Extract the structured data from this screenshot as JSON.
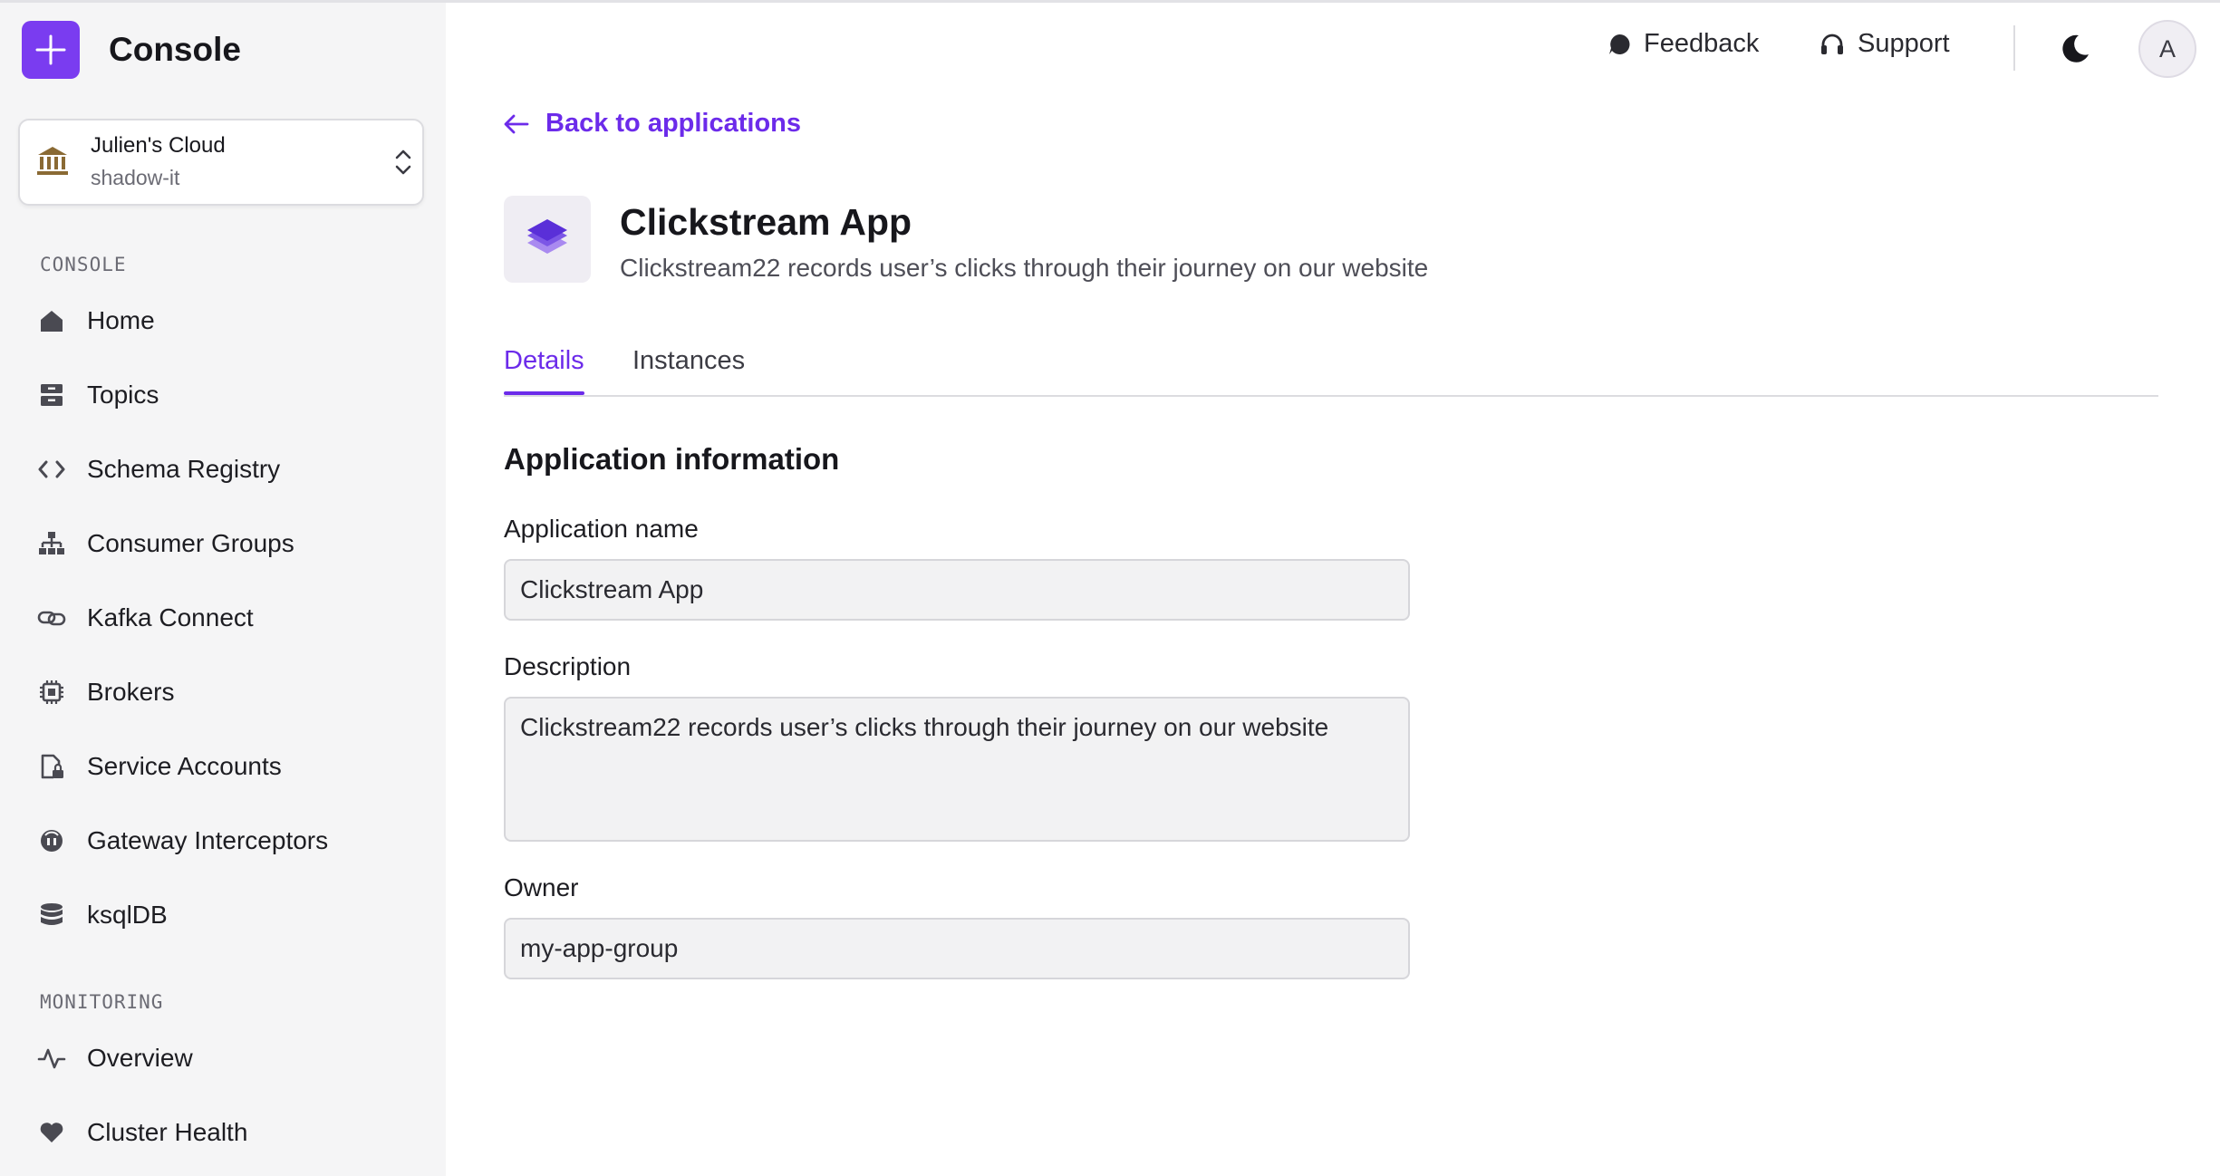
{
  "app": {
    "name": "Console",
    "accent": "#7a3cf0",
    "link_color": "#6c2bea"
  },
  "org": {
    "name": "Julien's Cloud",
    "sub": "shadow-it"
  },
  "sidebar": {
    "sections": [
      {
        "label": "CONSOLE",
        "items": [
          {
            "label": "Home",
            "icon": "home-icon"
          },
          {
            "label": "Topics",
            "icon": "topics-icon"
          },
          {
            "label": "Schema Registry",
            "icon": "code-icon"
          },
          {
            "label": "Consumer Groups",
            "icon": "hierarchy-icon"
          },
          {
            "label": "Kafka Connect",
            "icon": "link-icon"
          },
          {
            "label": "Brokers",
            "icon": "chip-icon"
          },
          {
            "label": "Service Accounts",
            "icon": "file-lock-icon"
          },
          {
            "label": "Gateway Interceptors",
            "icon": "gateway-icon"
          },
          {
            "label": "ksqlDB",
            "icon": "database-icon"
          }
        ]
      },
      {
        "label": "MONITORING",
        "items": [
          {
            "label": "Overview",
            "icon": "activity-icon"
          },
          {
            "label": "Cluster Health",
            "icon": "heart-icon"
          }
        ]
      }
    ]
  },
  "topbar": {
    "feedback": "Feedback",
    "support": "Support",
    "avatar_initial": "A"
  },
  "main": {
    "back_link": "Back to applications",
    "title": "Clickstream App",
    "description": "Clickstream22 records user’s clicks through their journey on our website",
    "tabs": [
      {
        "label": "Details",
        "active": true
      },
      {
        "label": "Instances",
        "active": false
      }
    ],
    "section_title": "Application information",
    "fields": {
      "name": {
        "label": "Application name",
        "value": "Clickstream App"
      },
      "description": {
        "label": "Description",
        "value": "Clickstream22 records user’s clicks through their journey on our website"
      },
      "owner": {
        "label": "Owner",
        "value": "my-app-group"
      }
    }
  }
}
